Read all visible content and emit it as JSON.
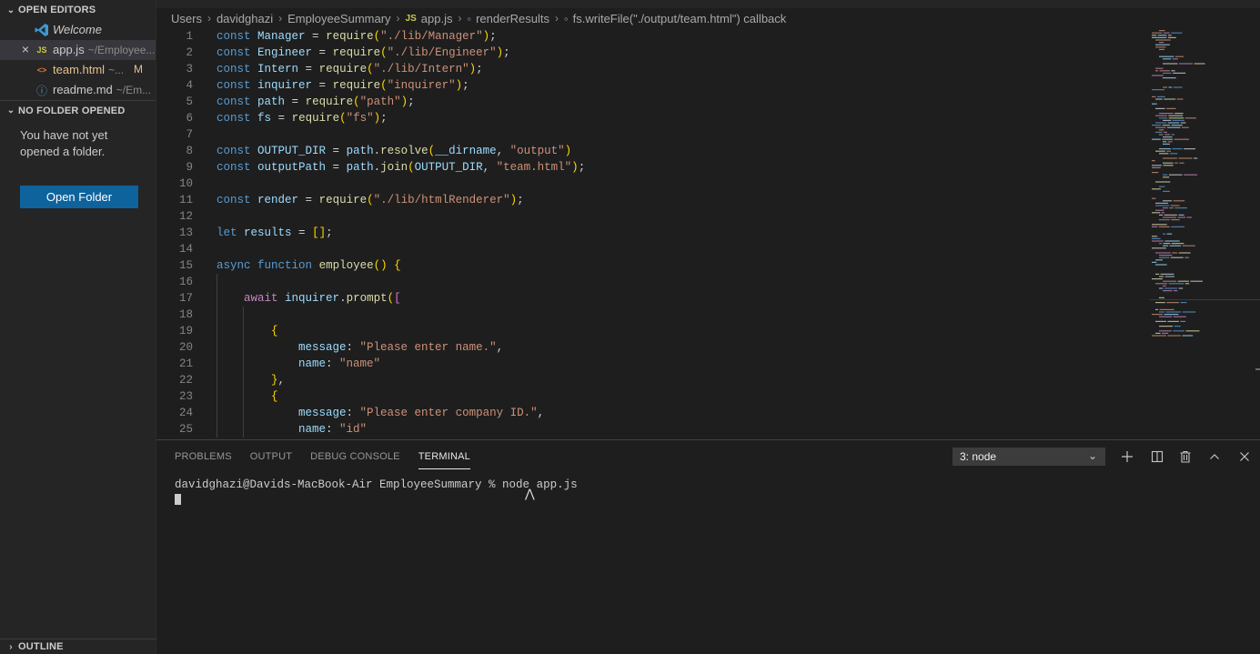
{
  "sidebar": {
    "open_editors_label": "OPEN EDITORS",
    "open_editors": [
      {
        "name": "Welcome",
        "path": "",
        "icon": "vscode-logo-icon",
        "italic": true
      },
      {
        "name": "app.js",
        "path": "~/Employee...",
        "icon": "js-file-icon",
        "icon_text": "JS",
        "active": true
      },
      {
        "name": "team.html",
        "path": "~...",
        "icon": "html-file-icon",
        "icon_text": "<>",
        "badge": "M"
      },
      {
        "name": "readme.md",
        "path": "~/Em...",
        "icon": "info-file-icon",
        "icon_text": "ⓘ"
      }
    ],
    "no_folder_label": "NO FOLDER OPENED",
    "no_folder_message": "You have not yet opened a folder.",
    "open_folder_button": "Open Folder",
    "outline_label": "OUTLINE"
  },
  "breadcrumb": {
    "items": [
      "Users",
      "davidghazi",
      "EmployeeSummary",
      "app.js",
      "renderResults",
      "fs.writeFile(\"./output/team.html\") callback"
    ]
  },
  "editor": {
    "lines": [
      {
        "n": "1",
        "t": "const Manager = require(\"./lib/Manager\");"
      },
      {
        "n": "2",
        "t": "const Engineer = require(\"./lib/Engineer\");"
      },
      {
        "n": "3",
        "t": "const Intern = require(\"./lib/Intern\");"
      },
      {
        "n": "4",
        "t": "const inquirer = require(\"inquirer\");"
      },
      {
        "n": "5",
        "t": "const path = require(\"path\");"
      },
      {
        "n": "6",
        "t": "const fs = require(\"fs\");"
      },
      {
        "n": "7",
        "t": ""
      },
      {
        "n": "8",
        "t": "const OUTPUT_DIR = path.resolve(__dirname, \"output\")"
      },
      {
        "n": "9",
        "t": "const outputPath = path.join(OUTPUT_DIR, \"team.html\");"
      },
      {
        "n": "10",
        "t": ""
      },
      {
        "n": "11",
        "t": "const render = require(\"./lib/htmlRenderer\");"
      },
      {
        "n": "12",
        "t": ""
      },
      {
        "n": "13",
        "t": "let results = [];"
      },
      {
        "n": "14",
        "t": ""
      },
      {
        "n": "15",
        "t": "async function employee() {"
      },
      {
        "n": "16",
        "t": ""
      },
      {
        "n": "17",
        "t": "    await inquirer.prompt(["
      },
      {
        "n": "18",
        "t": ""
      },
      {
        "n": "19",
        "t": "        {"
      },
      {
        "n": "20",
        "t": "            message: \"Please enter name.\","
      },
      {
        "n": "21",
        "t": "            name: \"name\""
      },
      {
        "n": "22",
        "t": "        },"
      },
      {
        "n": "23",
        "t": "        {"
      },
      {
        "n": "24",
        "t": "            message: \"Please enter company ID.\","
      },
      {
        "n": "25",
        "t": "            name: \"id\""
      }
    ]
  },
  "panel": {
    "tabs": [
      "PROBLEMS",
      "OUTPUT",
      "DEBUG CONSOLE",
      "TERMINAL"
    ],
    "active_tab": "TERMINAL",
    "terminal_select": "3: node",
    "actions": [
      "plus-icon",
      "split-icon",
      "trash-icon",
      "chevron-up-icon",
      "close-icon"
    ],
    "terminal_output": "davidghazi@Davids-MacBook-Air EmployeeSummary % node app.js"
  },
  "colors": {
    "accent_button": "#0e639c",
    "keyword": "#569cd6",
    "variable": "#9cdcfe",
    "function": "#dcdcaa",
    "string": "#ce9178",
    "control": "#c586c0"
  }
}
